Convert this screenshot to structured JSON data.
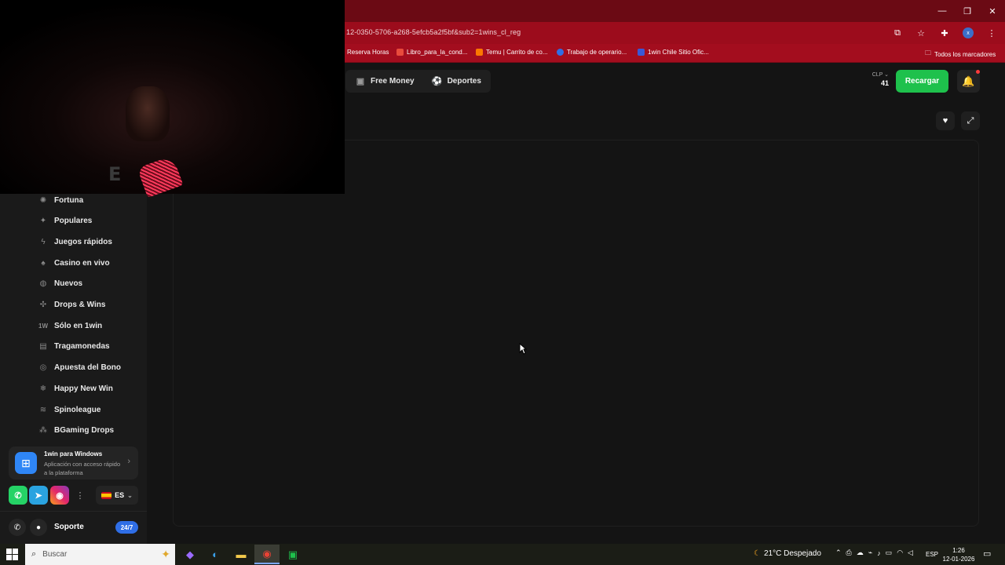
{
  "browser": {
    "url": "12-0350-5706-a268-5efcb5a2f5bf&sub2=1wins_cl_reg",
    "window_controls": [
      "—",
      "❐",
      "✕"
    ],
    "bookmarks": [
      {
        "label": "Reserva Horas",
        "icon": "bookmark-icon",
        "color": "#a30d1e"
      },
      {
        "label": "Libro_para_la_cond...",
        "icon": "bookmark-icon",
        "color": "#e84b3c"
      },
      {
        "label": "Temu | Carrito de co...",
        "icon": "temu-icon",
        "color": "#fb7701"
      },
      {
        "label": "Trabajo de operario...",
        "icon": "globe-icon",
        "color": "#2f6ee6"
      },
      {
        "label": "1win Chile Sitio Ofic...",
        "icon": "1win-icon",
        "color": "#3a58d6"
      }
    ],
    "all_bookmarks": "Todos los marcadores",
    "profile_initial": "x"
  },
  "topnav": {
    "items": [
      {
        "label": "Free Money",
        "icon": "money-icon"
      },
      {
        "label": "Deportes",
        "icon": "soccer-ball-icon"
      }
    ]
  },
  "account": {
    "currency": "CLP",
    "balance": "41",
    "recharge_label": "Recargar"
  },
  "sidebar": {
    "items": [
      {
        "label": "Fortuna",
        "icon": "fortune-wheel-icon"
      },
      {
        "label": "Populares",
        "icon": "sparkle-icon"
      },
      {
        "label": "Juegos rápidos",
        "icon": "lightning-icon"
      },
      {
        "label": "Casino en vivo",
        "icon": "spade-icon"
      },
      {
        "label": "Nuevos",
        "icon": "new-icon"
      },
      {
        "label": "Drops & Wins",
        "icon": "drops-icon"
      },
      {
        "label": "Sólo en 1win",
        "icon": "1win-only-icon"
      },
      {
        "label": "Tragamonedas",
        "icon": "slots-icon"
      },
      {
        "label": "Apuesta del Bono",
        "icon": "bonus-icon"
      },
      {
        "label": "Happy New Win",
        "icon": "snowflake-icon"
      },
      {
        "label": "Spinoleague",
        "icon": "league-icon"
      },
      {
        "label": "BGaming Drops",
        "icon": "bgaming-icon"
      }
    ],
    "app_card": {
      "title": "1win para Windows",
      "subtitle": "Aplicación con acceso rápido a la plataforma"
    },
    "language": "ES",
    "support": {
      "label": "Soporte",
      "badge": "24/7"
    }
  },
  "taskbar": {
    "search_placeholder": "Buscar",
    "weather": "21°C  Despejado",
    "input_lang": "ESP",
    "time": "1:26",
    "date": "12-01-2026"
  }
}
